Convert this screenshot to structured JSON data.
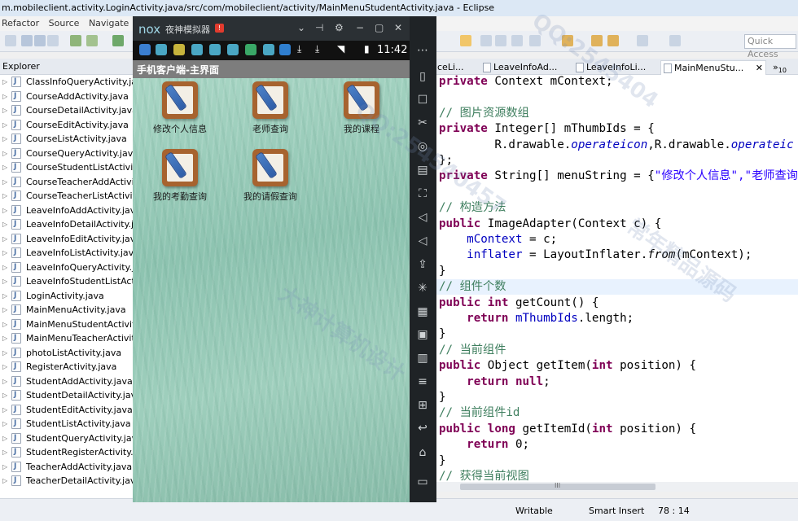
{
  "eclipse": {
    "title": "m.mobileclient.activity.LoginActivity.java/src/com/mobileclient/activity/MainMenuStudentActivity.java - Eclipse",
    "menu": [
      "Refactor",
      "Source",
      "Navigate"
    ],
    "quick_access": "Quick Access",
    "explorer_tab": "Explorer",
    "files": [
      "ClassInfoQueryActivity.java",
      "CourseAddActivity.java",
      "CourseDetailActivity.java",
      "CourseEditActivity.java",
      "CourseListActivity.java",
      "CourseQueryActivity.java",
      "CourseStudentListActivity.java",
      "CourseTeacherAddActivity.java",
      "CourseTeacherListActivity.java",
      "LeaveInfoAddActivity.java",
      "LeaveInfoDetailActivity.java",
      "LeaveInfoEditActivity.java",
      "LeaveInfoListActivity.java",
      "LeaveInfoQueryActivity.java",
      "LeaveInfoStudentListActivity.java",
      "LoginActivity.java",
      "MainMenuActivity.java",
      "MainMenuStudentActivity.java",
      "MainMenuTeacherActivity.java",
      "photoListActivity.java",
      "RegisterActivity.java",
      "StudentAddActivity.java",
      "StudentDetailActivity.java",
      "StudentEditActivity.java",
      "StudentListActivity.java",
      "StudentQueryActivity.java",
      "StudentRegisterActivity.java",
      "TeacherAddActivity.java",
      "TeacherDetailActivity.java"
    ],
    "editor_tabs": [
      "ceLi...",
      "LeaveInfoAd...",
      "LeaveInfoLi...",
      "MainMenuStu..."
    ],
    "overflow_tabs": "»",
    "overflow_count": "10",
    "status": {
      "writable": "Writable",
      "insert": "Smart Insert",
      "position": "78 : 14"
    },
    "scroll_grip": "III"
  },
  "code": [
    {
      "type": "plain",
      "pre": "",
      "kw": "private",
      "rest": " Context mContext;"
    },
    {
      "type": "blank"
    },
    {
      "type": "comment",
      "text": "// 图片资源数组"
    },
    {
      "type": "plain",
      "pre": "",
      "kw": "private",
      "rest": " Integer[] mThumbIds = {"
    },
    {
      "type": "rdrawable",
      "text": "        R.drawable.operateicon,R.drawable.operateic"
    },
    {
      "type": "raw",
      "text": "};"
    },
    {
      "type": "menustring",
      "kw": "private",
      "mid": " String[] menuString = {",
      "str": "\"修改个人信息\",\"老师查询"
    },
    {
      "type": "blank"
    },
    {
      "type": "comment",
      "text": "// 构造方法"
    },
    {
      "type": "plain",
      "pre": "",
      "kw": "public",
      "rest": " ImageAdapter(Context c) {"
    },
    {
      "type": "assign",
      "text1": "    ",
      "fld": "mContext",
      "text2": " = c;"
    },
    {
      "type": "inflater",
      "text1": "    ",
      "fld": "inflater",
      "text2": " = LayoutInflater.",
      "it": "from",
      "text3": "(mContext);"
    },
    {
      "type": "raw",
      "text": "}"
    },
    {
      "type": "comment",
      "text": "// 组件个数",
      "hl": true
    },
    {
      "type": "count",
      "kw": "public",
      "kw2": "int",
      "rest": " getCount() {"
    },
    {
      "type": "return",
      "pre": "    ",
      "kw": "return",
      "fld": " mThumbIds",
      "rest": ".length;"
    },
    {
      "type": "raw",
      "text": "}"
    },
    {
      "type": "comment",
      "text": "// 当前组件"
    },
    {
      "type": "getitem",
      "kw": "public",
      "rest": " Object getItem(",
      "kw2": "int",
      "rest2": " position) {"
    },
    {
      "type": "returnkw",
      "pre": "    ",
      "kw": "return",
      "kw2": " null",
      "rest": ";"
    },
    {
      "type": "raw",
      "text": "}"
    },
    {
      "type": "comment",
      "text": "// 当前组件id"
    },
    {
      "type": "getitemid",
      "kw": "public",
      "kw2": " long",
      "rest": " getItemId(",
      "kw3": "int",
      "rest2": " position) {"
    },
    {
      "type": "return0",
      "pre": "    ",
      "kw": "return",
      "rest": " 0;"
    },
    {
      "type": "raw",
      "text": "}"
    },
    {
      "type": "comment",
      "text": "// 获得当前视图"
    }
  ],
  "nox": {
    "logo": "nox",
    "name": "夜神模拟器",
    "badge": "!",
    "time": "11:42",
    "app_title": "手机客户端-主界面",
    "menu_items": [
      {
        "label": "修改个人信息",
        "icon": "notebook-pen-icon"
      },
      {
        "label": "老师查询",
        "icon": "notebook-pen-icon"
      },
      {
        "label": "我的课程",
        "icon": "notebook-pen-icon"
      },
      {
        "label": "我的考勤查询",
        "icon": "notebook-pen-icon"
      },
      {
        "label": "我的请假查询",
        "icon": "notebook-pen-icon"
      }
    ]
  },
  "watermarks": [
    "QQ:254540457",
    "大神计算机设计",
    "常年精品源码",
    "QQ:2545404"
  ]
}
